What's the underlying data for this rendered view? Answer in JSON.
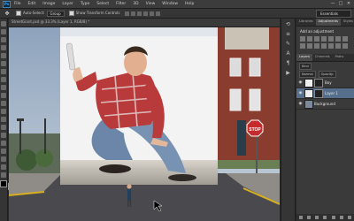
{
  "menubar": {
    "logo": "Ps",
    "items": [
      "File",
      "Edit",
      "Image",
      "Layer",
      "Type",
      "Select",
      "Filter",
      "3D",
      "View",
      "Window",
      "Help"
    ],
    "controls": [
      "—",
      "□",
      "✕"
    ]
  },
  "options": {
    "auto_select": "Auto-Select:",
    "auto_select_value": "Group",
    "show_transform": "Show Transform Controls",
    "workspace": "Essentials"
  },
  "document": {
    "tab_label": "StreetGiant.psd @ 33.3% (Layer 1, RGB/8) *"
  },
  "adjustments": {
    "tabs": [
      "Libraries",
      "Adjustments",
      "Styles"
    ],
    "title": "Add an adjustment"
  },
  "layers": {
    "tabs": [
      "Layers",
      "Channels",
      "Paths"
    ],
    "kind_label": "Kind",
    "blend_mode": "Normal",
    "opacity_label": "Opacity:",
    "items": [
      {
        "name": "Boy"
      },
      {
        "name": "Layer 1"
      },
      {
        "name": "Background"
      }
    ]
  },
  "colors": {
    "accent": "#31a8ff",
    "selected_layer": "#556f8c",
    "panel_bg": "#3a3a3a"
  }
}
